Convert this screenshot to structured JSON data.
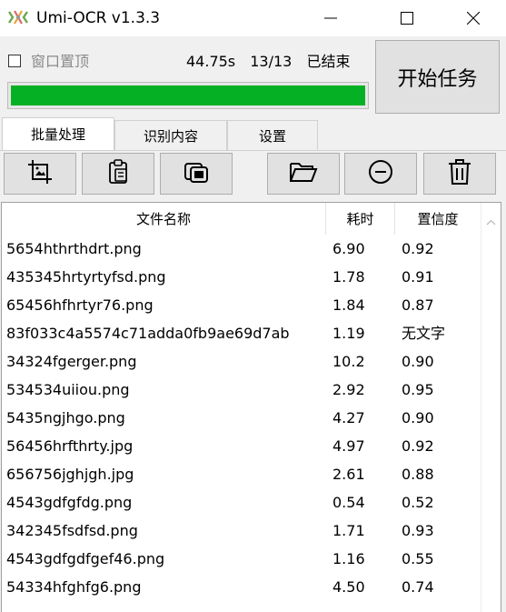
{
  "window": {
    "title": "Umi-OCR v1.3.3",
    "icon": "umi-ocr-app-icon",
    "controls": [
      "minimize-icon",
      "maximize-icon",
      "close-icon"
    ]
  },
  "top": {
    "checkbox_label": "窗口置顶",
    "checkbox_checked": false,
    "elapsed": "44.75s",
    "count": "13/13",
    "state": "已结束",
    "progress": 1.0,
    "progress_color": "#06b025",
    "start_button": "开始任务"
  },
  "tabs": [
    {
      "label": "批量处理",
      "active": true
    },
    {
      "label": "识别内容",
      "active": false
    },
    {
      "label": "设置",
      "active": false
    }
  ],
  "toolbar": {
    "icons": [
      "screenshot-icon",
      "clipboard-icon",
      "copy-icon",
      "folder-icon",
      "remove-icon",
      "delete-icon"
    ]
  },
  "table": {
    "headers": [
      "文件名称",
      "耗时",
      "置信度"
    ],
    "rows": [
      [
        "5654hthrthdrt.png",
        "6.90",
        "0.92"
      ],
      [
        "435345hrtyrtyfsd.png",
        "1.78",
        "0.91"
      ],
      [
        "65456hfhrtyr76.png",
        "1.84",
        "0.87"
      ],
      [
        "83f033c4a5574c71adda0fb9ae69d7ab",
        "1.19",
        "无文字"
      ],
      [
        "34324fgerger.png",
        "10.2",
        "0.90"
      ],
      [
        "534534uiiou.png",
        "2.92",
        "0.95"
      ],
      [
        "5435ngjhgo.png",
        "4.27",
        "0.90"
      ],
      [
        "56456hrfthrty.jpg",
        "4.97",
        "0.92"
      ],
      [
        "656756jghjgh.jpg",
        "2.61",
        "0.88"
      ],
      [
        "4543gdfgfdg.png",
        "0.54",
        "0.52"
      ],
      [
        "342345fsdfsd.png",
        "1.71",
        "0.93"
      ],
      [
        "4543gdfgdfgef46.png",
        "1.16",
        "0.55"
      ],
      [
        "54334hfghfg6.png",
        "4.50",
        "0.74"
      ]
    ]
  }
}
